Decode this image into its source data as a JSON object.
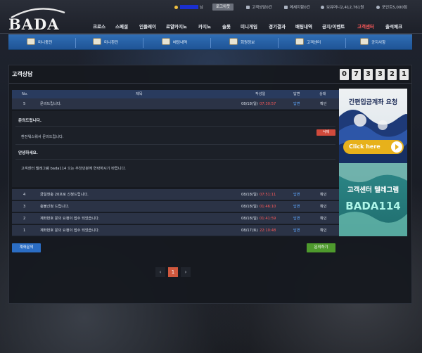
{
  "brand": {
    "logo_text": "BADA"
  },
  "status_bar": {
    "user_suffix": "님",
    "logout_label": "로그아웃",
    "inquiry_count": "고객상담0건",
    "message_count": "메세지함0건",
    "balance": "보유머니2,412,761원",
    "points": "포인트5,000점"
  },
  "main_nav": [
    "크로스",
    "스페셜",
    "인플레이",
    "로얄카지노",
    "카지노",
    "슬롯",
    "미니게임",
    "경기결과",
    "배팅내역",
    "공지/이벤트",
    "고객센터",
    "출석체크"
  ],
  "main_nav_active": "고객센터",
  "sub_nav": [
    "미니충전",
    "미니환전",
    "베팅내역",
    "회원정보",
    "고객센터",
    "공지사항"
  ],
  "page": {
    "title": "고객상담",
    "counter": [
      "0",
      "7",
      "3",
      "3",
      "2",
      "1"
    ]
  },
  "table": {
    "headers": {
      "no": "No.",
      "subject": "제목",
      "date": "작성일",
      "reply": "답변",
      "status": "상태"
    },
    "open_row": {
      "no": "5",
      "subject": "문의드립니다.",
      "date": "08/18(일)",
      "time": "07:30:57",
      "reply": "답변",
      "status": "확인"
    },
    "rows": [
      {
        "no": "4",
        "subject": "금일첫충 20프로 신청드립니다.",
        "date": "08/18(일)",
        "time": "07:51:11",
        "reply": "답변",
        "status": "확인"
      },
      {
        "no": "3",
        "subject": "충불신청 드립니다.",
        "date": "08/18(일)",
        "time": "01:46:10",
        "reply": "답변",
        "status": "확인"
      },
      {
        "no": "2",
        "subject": "계좌번호 문의 요청이 접수 되었습니다.",
        "date": "08/18(일)",
        "time": "01:41:59",
        "reply": "답변",
        "status": "확인"
      },
      {
        "no": "1",
        "subject": "계좌번호 문의 요청이 접수 되었습니다.",
        "date": "08/17(토)",
        "time": "22:10:48",
        "reply": "답변",
        "status": "확인"
      }
    ]
  },
  "detail": {
    "question_title": "문의드립니다.",
    "question_body": "환전워스워서 문의드립니다.",
    "delete_label": "삭제",
    "answer_title": "안녕하세요.",
    "answer_body": "고객센터 텔레그램 bada114 으는 추천인분께 연락하시기 바랍니다."
  },
  "buttons": {
    "account_inquiry": "계좌문의",
    "write_inquiry": "문의하기"
  },
  "pagination": {
    "prev": "‹",
    "current": "1",
    "next": "›"
  },
  "banners": {
    "top_text": "간편입금계좌 요청",
    "top_button": "Click here",
    "bottom_line1": "고객센터 텔레그램",
    "bottom_line2": "BADA114"
  }
}
